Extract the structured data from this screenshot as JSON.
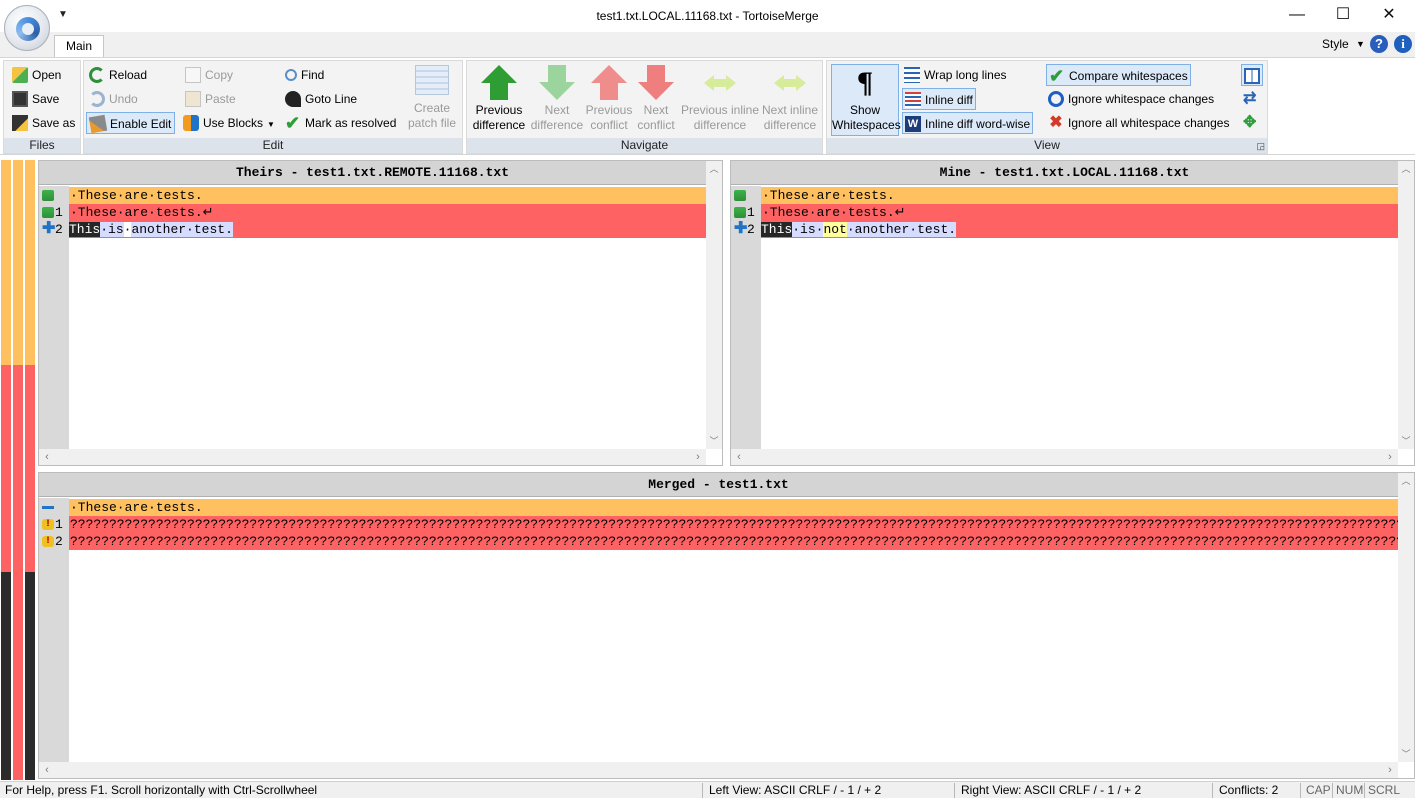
{
  "window": {
    "title": "test1.txt.LOCAL.11168.txt - TortoiseMerge",
    "minimize": "—",
    "maximize": "☐",
    "close": "✕"
  },
  "tabs": {
    "main": "Main",
    "style": "Style",
    "help": "?",
    "info": "i"
  },
  "ribbon": {
    "files": {
      "label": "Files",
      "open": "Open",
      "save": "Save",
      "save_as": "Save as"
    },
    "edit": {
      "label": "Edit",
      "reload": "Reload",
      "undo": "Undo",
      "enable_edit": "Enable Edit",
      "copy": "Copy",
      "paste": "Paste",
      "use_blocks": "Use Blocks",
      "find": "Find",
      "goto_line": "Goto Line",
      "mark_resolved": "Mark as resolved",
      "create_patch_1": "Create",
      "create_patch_2": "patch file"
    },
    "navigate": {
      "label": "Navigate",
      "prev_diff_1": "Previous",
      "prev_diff_2": "difference",
      "next_diff_1": "Next",
      "next_diff_2": "difference",
      "prev_conflict_1": "Previous",
      "prev_conflict_2": "conflict",
      "next_conflict_1": "Next",
      "next_conflict_2": "conflict",
      "prev_inline_1": "Previous inline",
      "prev_inline_2": "difference",
      "next_inline_1": "Next inline",
      "next_inline_2": "difference"
    },
    "view": {
      "label": "View",
      "show_ws_1": "Show",
      "show_ws_2": "Whitespaces",
      "wrap": "Wrap long lines",
      "inline_diff": "Inline diff",
      "inline_diff_word": "Inline diff word-wise",
      "compare_ws": "Compare whitespaces",
      "ignore_ws_changes": "Ignore whitespace changes",
      "ignore_all_ws": "Ignore all whitespace changes"
    }
  },
  "panes": {
    "theirs": {
      "header": "Theirs - test1.txt.REMOTE.11168.txt",
      "lines": [
        {
          "no": "",
          "text": "·These·are·tests."
        },
        {
          "no": "1",
          "text": "·These·are·tests.↵"
        },
        {
          "no": "2",
          "w1": "This",
          "w2": "·",
          "w3": "is",
          "w4": "·",
          "w5": "another·test."
        }
      ]
    },
    "mine": {
      "header": "Mine - test1.txt.LOCAL.11168.txt",
      "lines": [
        {
          "no": "",
          "text": "·These·are·tests."
        },
        {
          "no": "1",
          "text": "·These·are·tests.↵"
        },
        {
          "no": "2",
          "w1": "This",
          "w2": "·",
          "w3": "is",
          "w4": "·",
          "w5": "not",
          "w6": "·another·test."
        }
      ]
    },
    "merged": {
      "header": "Merged - test1.txt",
      "lines": [
        {
          "no": "",
          "text": "·These·are·tests."
        },
        {
          "no": "1",
          "text": "????????????????????????????????????????????????????????????????????????????????????????????????????????????????????????????????????????????????????????????????????????????????????"
        },
        {
          "no": "2",
          "text": "????????????????????????????????????????????????????????????????????????????????????????????????????????????????????????????????????????????????????????????????????????????????????"
        }
      ]
    }
  },
  "status": {
    "help": "For Help, press F1. Scroll horizontally with Ctrl-Scrollwheel",
    "left_view": "Left View: ASCII CRLF  / - 1 / + 2",
    "right_view": "Right View: ASCII CRLF  / - 1 / + 2",
    "conflicts": "Conflicts: 2",
    "cap": "CAP",
    "num": "NUM",
    "scrl": "SCRL"
  },
  "colors": {
    "conflict_orange": "#ffc060",
    "conflict_red": "#ff6262",
    "inline_dark": "#262626",
    "inline_light": "#d6dcff",
    "inline_yellow": "#ffff9e"
  }
}
